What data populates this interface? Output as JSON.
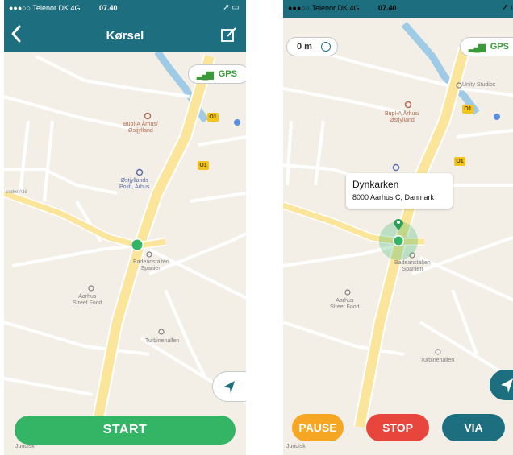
{
  "left_screen": {
    "status": {
      "carrier": "●●●○○ Telenor DK  4G",
      "time": "07.40"
    },
    "nav": {
      "title": "Kørsel"
    },
    "gps": {
      "label": "GPS"
    },
    "map_labels": {
      "poi1": "Bupl-A Århus/\nØstjylland",
      "poi2": "Østjyllands\nPoliti, Århus",
      "poi3": "Badeanstalten\nSpanien",
      "poi4": "Aarhus\nStreet Food",
      "poi5": "Turbinehallen",
      "road1": "O1",
      "road2": "O1",
      "street1": "ender Allé"
    },
    "start_label": "START",
    "legal": "Juridisk"
  },
  "right_screen": {
    "status": {
      "carrier": "●●●○○ Telenor DK  4G",
      "time": "07.40"
    },
    "distance": "0 m",
    "gps": {
      "label": "GPS"
    },
    "map_labels": {
      "poi1": "Bupl-A Århus/\nØstjylland",
      "poi0": "Unity Studios",
      "poi3": "Badeanstalten\nSpanien",
      "poi4": "Aarhus\nStreet Food",
      "poi5": "Turbinehallen",
      "road1": "O1",
      "road2": "O1"
    },
    "callout": {
      "title": "Dynkarken",
      "address": "8000 Aarhus C, Danmark"
    },
    "buttons": {
      "pause": "PAUSE",
      "stop": "STOP",
      "via": "VIA"
    },
    "legal": "Juridisk"
  },
  "colors": {
    "nav": "#1d6f7f",
    "start": "#34b566",
    "pause": "#f5a623",
    "stop": "#e8453c",
    "via": "#1d6f7f",
    "gps_text": "#3a9a3a"
  }
}
